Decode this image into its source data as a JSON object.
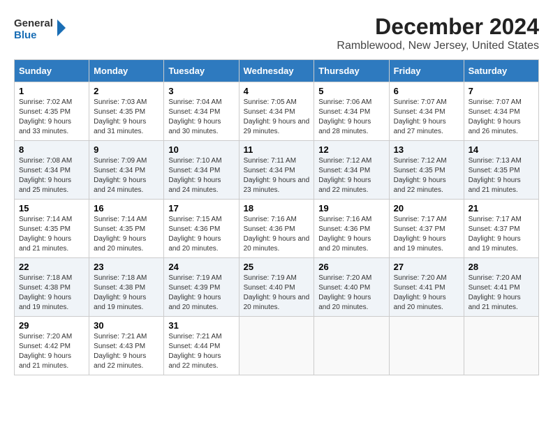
{
  "header": {
    "logo_line1": "General",
    "logo_line2": "Blue",
    "title": "December 2024",
    "subtitle": "Ramblewood, New Jersey, United States"
  },
  "columns": [
    "Sunday",
    "Monday",
    "Tuesday",
    "Wednesday",
    "Thursday",
    "Friday",
    "Saturday"
  ],
  "weeks": [
    [
      {
        "day": "1",
        "sunrise": "Sunrise: 7:02 AM",
        "sunset": "Sunset: 4:35 PM",
        "daylight": "Daylight: 9 hours and 33 minutes."
      },
      {
        "day": "2",
        "sunrise": "Sunrise: 7:03 AM",
        "sunset": "Sunset: 4:35 PM",
        "daylight": "Daylight: 9 hours and 31 minutes."
      },
      {
        "day": "3",
        "sunrise": "Sunrise: 7:04 AM",
        "sunset": "Sunset: 4:34 PM",
        "daylight": "Daylight: 9 hours and 30 minutes."
      },
      {
        "day": "4",
        "sunrise": "Sunrise: 7:05 AM",
        "sunset": "Sunset: 4:34 PM",
        "daylight": "Daylight: 9 hours and 29 minutes."
      },
      {
        "day": "5",
        "sunrise": "Sunrise: 7:06 AM",
        "sunset": "Sunset: 4:34 PM",
        "daylight": "Daylight: 9 hours and 28 minutes."
      },
      {
        "day": "6",
        "sunrise": "Sunrise: 7:07 AM",
        "sunset": "Sunset: 4:34 PM",
        "daylight": "Daylight: 9 hours and 27 minutes."
      },
      {
        "day": "7",
        "sunrise": "Sunrise: 7:07 AM",
        "sunset": "Sunset: 4:34 PM",
        "daylight": "Daylight: 9 hours and 26 minutes."
      }
    ],
    [
      {
        "day": "8",
        "sunrise": "Sunrise: 7:08 AM",
        "sunset": "Sunset: 4:34 PM",
        "daylight": "Daylight: 9 hours and 25 minutes."
      },
      {
        "day": "9",
        "sunrise": "Sunrise: 7:09 AM",
        "sunset": "Sunset: 4:34 PM",
        "daylight": "Daylight: 9 hours and 24 minutes."
      },
      {
        "day": "10",
        "sunrise": "Sunrise: 7:10 AM",
        "sunset": "Sunset: 4:34 PM",
        "daylight": "Daylight: 9 hours and 24 minutes."
      },
      {
        "day": "11",
        "sunrise": "Sunrise: 7:11 AM",
        "sunset": "Sunset: 4:34 PM",
        "daylight": "Daylight: 9 hours and 23 minutes."
      },
      {
        "day": "12",
        "sunrise": "Sunrise: 7:12 AM",
        "sunset": "Sunset: 4:34 PM",
        "daylight": "Daylight: 9 hours and 22 minutes."
      },
      {
        "day": "13",
        "sunrise": "Sunrise: 7:12 AM",
        "sunset": "Sunset: 4:35 PM",
        "daylight": "Daylight: 9 hours and 22 minutes."
      },
      {
        "day": "14",
        "sunrise": "Sunrise: 7:13 AM",
        "sunset": "Sunset: 4:35 PM",
        "daylight": "Daylight: 9 hours and 21 minutes."
      }
    ],
    [
      {
        "day": "15",
        "sunrise": "Sunrise: 7:14 AM",
        "sunset": "Sunset: 4:35 PM",
        "daylight": "Daylight: 9 hours and 21 minutes."
      },
      {
        "day": "16",
        "sunrise": "Sunrise: 7:14 AM",
        "sunset": "Sunset: 4:35 PM",
        "daylight": "Daylight: 9 hours and 20 minutes."
      },
      {
        "day": "17",
        "sunrise": "Sunrise: 7:15 AM",
        "sunset": "Sunset: 4:36 PM",
        "daylight": "Daylight: 9 hours and 20 minutes."
      },
      {
        "day": "18",
        "sunrise": "Sunrise: 7:16 AM",
        "sunset": "Sunset: 4:36 PM",
        "daylight": "Daylight: 9 hours and 20 minutes."
      },
      {
        "day": "19",
        "sunrise": "Sunrise: 7:16 AM",
        "sunset": "Sunset: 4:36 PM",
        "daylight": "Daylight: 9 hours and 20 minutes."
      },
      {
        "day": "20",
        "sunrise": "Sunrise: 7:17 AM",
        "sunset": "Sunset: 4:37 PM",
        "daylight": "Daylight: 9 hours and 19 minutes."
      },
      {
        "day": "21",
        "sunrise": "Sunrise: 7:17 AM",
        "sunset": "Sunset: 4:37 PM",
        "daylight": "Daylight: 9 hours and 19 minutes."
      }
    ],
    [
      {
        "day": "22",
        "sunrise": "Sunrise: 7:18 AM",
        "sunset": "Sunset: 4:38 PM",
        "daylight": "Daylight: 9 hours and 19 minutes."
      },
      {
        "day": "23",
        "sunrise": "Sunrise: 7:18 AM",
        "sunset": "Sunset: 4:38 PM",
        "daylight": "Daylight: 9 hours and 19 minutes."
      },
      {
        "day": "24",
        "sunrise": "Sunrise: 7:19 AM",
        "sunset": "Sunset: 4:39 PM",
        "daylight": "Daylight: 9 hours and 20 minutes."
      },
      {
        "day": "25",
        "sunrise": "Sunrise: 7:19 AM",
        "sunset": "Sunset: 4:40 PM",
        "daylight": "Daylight: 9 hours and 20 minutes."
      },
      {
        "day": "26",
        "sunrise": "Sunrise: 7:20 AM",
        "sunset": "Sunset: 4:40 PM",
        "daylight": "Daylight: 9 hours and 20 minutes."
      },
      {
        "day": "27",
        "sunrise": "Sunrise: 7:20 AM",
        "sunset": "Sunset: 4:41 PM",
        "daylight": "Daylight: 9 hours and 20 minutes."
      },
      {
        "day": "28",
        "sunrise": "Sunrise: 7:20 AM",
        "sunset": "Sunset: 4:41 PM",
        "daylight": "Daylight: 9 hours and 21 minutes."
      }
    ],
    [
      {
        "day": "29",
        "sunrise": "Sunrise: 7:20 AM",
        "sunset": "Sunset: 4:42 PM",
        "daylight": "Daylight: 9 hours and 21 minutes."
      },
      {
        "day": "30",
        "sunrise": "Sunrise: 7:21 AM",
        "sunset": "Sunset: 4:43 PM",
        "daylight": "Daylight: 9 hours and 22 minutes."
      },
      {
        "day": "31",
        "sunrise": "Sunrise: 7:21 AM",
        "sunset": "Sunset: 4:44 PM",
        "daylight": "Daylight: 9 hours and 22 minutes."
      },
      null,
      null,
      null,
      null
    ]
  ]
}
